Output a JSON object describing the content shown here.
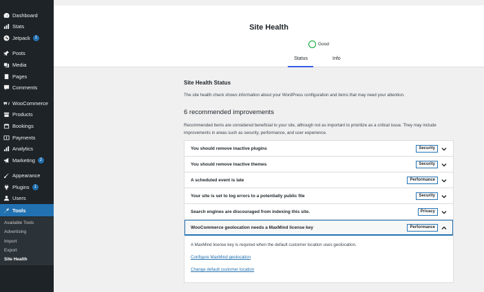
{
  "sidebar": {
    "items": [
      {
        "label": "Dashboard",
        "icon": "dashboard-icon",
        "badge": ""
      },
      {
        "label": "Stats",
        "icon": "stats-icon",
        "badge": ""
      },
      {
        "label": "Jetpack",
        "icon": "jetpack-icon",
        "badge": "1"
      },
      {
        "label": "Posts",
        "icon": "pin-icon",
        "badge": ""
      },
      {
        "label": "Media",
        "icon": "media-icon",
        "badge": ""
      },
      {
        "label": "Pages",
        "icon": "pages-icon",
        "badge": ""
      },
      {
        "label": "Comments",
        "icon": "comments-icon",
        "badge": ""
      },
      {
        "label": "WooCommerce",
        "icon": "woocommerce-icon",
        "badge": ""
      },
      {
        "label": "Products",
        "icon": "products-icon",
        "badge": ""
      },
      {
        "label": "Bookings",
        "icon": "calendar-icon",
        "badge": ""
      },
      {
        "label": "Payments",
        "icon": "payments-icon",
        "badge": ""
      },
      {
        "label": "Analytics",
        "icon": "analytics-icon",
        "badge": ""
      },
      {
        "label": "Marketing",
        "icon": "megaphone-icon",
        "badge": "2"
      },
      {
        "label": "Appearance",
        "icon": "brush-icon",
        "badge": ""
      },
      {
        "label": "Plugins",
        "icon": "plugin-icon",
        "badge": "1"
      },
      {
        "label": "Users",
        "icon": "user-icon",
        "badge": ""
      },
      {
        "label": "Tools",
        "icon": "wrench-icon",
        "badge": ""
      }
    ],
    "submenu": [
      "Available Tools",
      "Advertising",
      "Import",
      "Export",
      "Site Health"
    ]
  },
  "header": {
    "title": "Site Health",
    "status": "Good",
    "tabs": [
      "Status",
      "Info"
    ]
  },
  "main": {
    "status_title": "Site Health Status",
    "status_desc": "The site health check shows information about your WordPress configuration and items that may need your attention.",
    "recommended_title": "6 recommended improvements",
    "recommended_desc": "Recommended items are considered beneficial to your site, although not as important to prioritize as a critical issue. They may include improvements in areas such as security, performance, and user experience.",
    "items": [
      {
        "label": "You should remove inactive plugins",
        "tag": "Security"
      },
      {
        "label": "You should remove inactive themes",
        "tag": "Security"
      },
      {
        "label": "A scheduled event is late",
        "tag": "Performance"
      },
      {
        "label": "Your site is set to log errors to a potentially public file",
        "tag": "Security"
      },
      {
        "label": "Search engines are discouraged from indexing this site.",
        "tag": "Privacy"
      },
      {
        "label": "WooCommerce geolocation needs a MaxMind license key",
        "tag": "Performance"
      }
    ],
    "panel": {
      "text": "A MaxMind license key is required when the default customer location uses geolocation.",
      "link1": "Configure MaxMind geolocation",
      "link2": "Change default customer location"
    }
  },
  "colors": {
    "accent": "#2271b1",
    "sidebar_bg": "#1d2327",
    "good": "#00a32a",
    "tab_underline": "#3858e9"
  }
}
